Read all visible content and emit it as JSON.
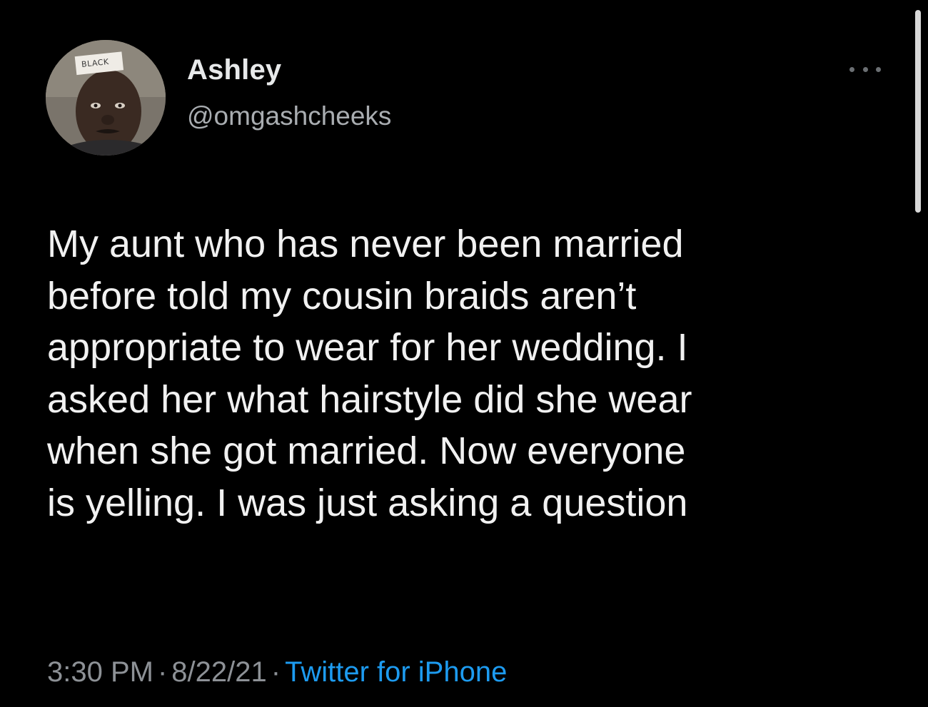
{
  "author": {
    "name": "Ashley",
    "handle": "@omgashcheeks",
    "avatar_icon": "profile-photo",
    "avatar_sticker_text": "BLACK"
  },
  "more_icon": "more-horizontal-icon",
  "tweet": {
    "lines": [
      "My aunt who has never been married",
      "before told my cousin braids aren’t",
      "appropriate to wear for her wedding. I",
      "asked her what hairstyle did she wear",
      "when she got married. Now everyone",
      "is yelling. I was just asking a question"
    ]
  },
  "meta": {
    "time": "3:30 PM",
    "separator": "·",
    "date": "8/22/21",
    "source": "Twitter for iPhone"
  },
  "colors": {
    "background": "#000000",
    "text": "#e7e9ea",
    "secondary_text": "#8d9196",
    "link": "#1d9bf0"
  }
}
